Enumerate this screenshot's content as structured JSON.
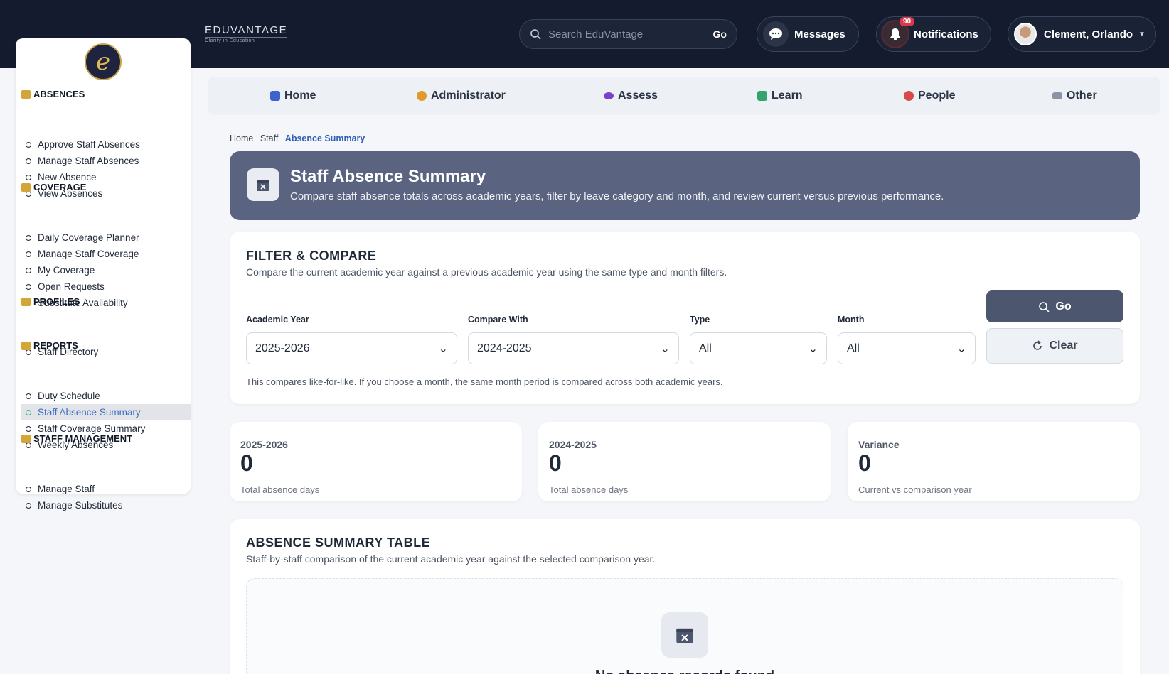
{
  "brand": {
    "name": "EDUVANTAGE",
    "tagline": "Clarity in Education"
  },
  "search": {
    "placeholder": "Search EduVantage",
    "go_label": "Go"
  },
  "header": {
    "messages_label": "Messages",
    "notifications_label": "Notifications",
    "notifications_count": "90",
    "user_name": "Clement, Orlando"
  },
  "sidebar": {
    "logo_letter": "e",
    "sections": [
      {
        "title": "ABSENCES",
        "items": [
          "Approve Staff Absences",
          "Manage Staff Absences",
          "New Absence",
          "View Absences"
        ]
      },
      {
        "title": "COVERAGE",
        "items": [
          "Daily Coverage Planner",
          "Manage Staff Coverage",
          "My Coverage",
          "Open Requests",
          "Substitute Availability"
        ]
      },
      {
        "title": "PROFILES",
        "items": [
          "Staff Directory"
        ]
      },
      {
        "title": "REPORTS",
        "items": [
          "Duty Schedule",
          "Staff Absence Summary",
          "Staff Coverage Summary",
          "Weekly Absences"
        ]
      },
      {
        "title": "STAFF MANAGEMENT",
        "items": [
          "Manage Staff",
          "Manage Substitutes"
        ]
      }
    ],
    "active_item": "Staff Absence Summary"
  },
  "nav": {
    "tabs": [
      "Home",
      "Administrator",
      "Assess",
      "Learn",
      "People",
      "Other"
    ]
  },
  "breadcrumb": [
    "Home",
    "Staff",
    "Absence Summary"
  ],
  "hero": {
    "title": "Staff Absence Summary",
    "subtitle": "Compare staff absence totals across academic years, filter by leave category and month, and review current versus previous performance."
  },
  "filter": {
    "title": "FILTER & COMPARE",
    "subtitle": "Compare the current academic year against a previous academic year using the same type and month filters.",
    "fields": [
      {
        "label": "Academic Year",
        "value": "2025-2026"
      },
      {
        "label": "Compare With",
        "value": "2024-2025"
      },
      {
        "label": "Type",
        "value": "All"
      },
      {
        "label": "Month",
        "value": "All"
      }
    ],
    "go_label": "Go",
    "clear_label": "Clear",
    "note": "This compares like-for-like. If you choose a month, the same month period is compared across both academic years."
  },
  "stats": [
    {
      "label": "2025-2026",
      "value": "0",
      "sub": "Total absence days"
    },
    {
      "label": "2024-2025",
      "value": "0",
      "sub": "Total absence days"
    },
    {
      "label": "Variance",
      "value": "0",
      "sub": "Current vs comparison year"
    }
  ],
  "table": {
    "title": "ABSENCE SUMMARY TABLE",
    "subtitle": "Staff-by-staff comparison of the current academic year against the selected comparison year.",
    "empty_text": "No absence records found"
  },
  "colors": {
    "topbar": "#141b2e",
    "hero": "#5a6480",
    "accent": "#2f5fb8",
    "section_icon": "#d4a537"
  }
}
